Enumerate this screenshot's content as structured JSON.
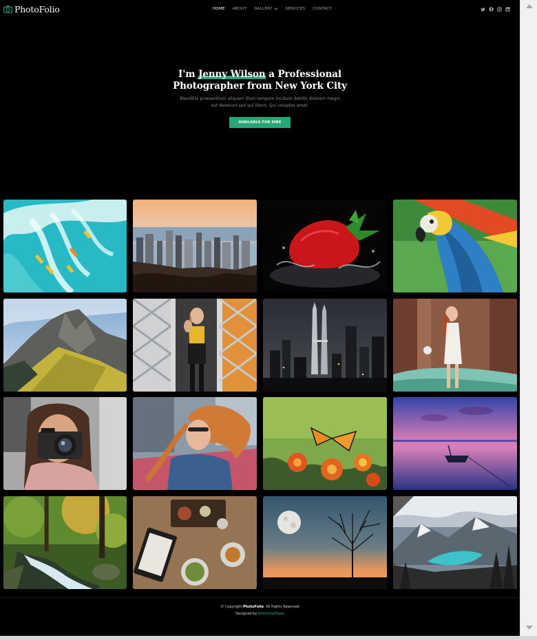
{
  "brand": {
    "name": "PhotoFolio",
    "icon": "camera-icon",
    "accent": "#27a776"
  },
  "nav": {
    "items": [
      {
        "label": "HOME",
        "active": true
      },
      {
        "label": "ABOUT",
        "active": false
      },
      {
        "label": "GALLERY",
        "active": false,
        "has_dropdown": true
      },
      {
        "label": "SERVICES",
        "active": false
      },
      {
        "label": "CONTACT",
        "active": false
      }
    ]
  },
  "socials": [
    "twitter-icon",
    "facebook-icon",
    "instagram-icon",
    "linkedin-icon"
  ],
  "hero": {
    "title_pre": "I'm ",
    "title_name": "Jenny Wilson",
    "title_post_line1": " a Professional",
    "title_line2": "Photographer from New York City",
    "subtitle": "Blanditiis praesentium aliquam illum tempore incidunt debitis dolorem magni est deserunt sed qui libero. Qui voluptas amet.",
    "button_label": "AVAILABLE FOR HIRE"
  },
  "gallery": {
    "items": [
      "surfers-wave-photo",
      "city-skyline-sunset-photo",
      "strawberry-splash-photo",
      "macaw-parrot-photo",
      "mountain-ridge-photo",
      "fashion-woman-mirror-photo",
      "twin-towers-night-photo",
      "woman-forest-photo",
      "woman-camera-photo",
      "woman-hair-blowing-photo",
      "butterfly-flowers-photo",
      "lake-boat-sunset-photo",
      "forest-waterfall-photo",
      "food-table-menu-photo",
      "moon-tree-silhouette-photo",
      "mountain-lake-valley-photo"
    ]
  },
  "footer": {
    "copyright_prefix": "© Copyright ",
    "copyright_brand": "PhotoFolio",
    "copyright_suffix": ". All Rights Reserved",
    "designed_by_prefix": "Designed by ",
    "designed_by_link": "BootstrapMade"
  }
}
